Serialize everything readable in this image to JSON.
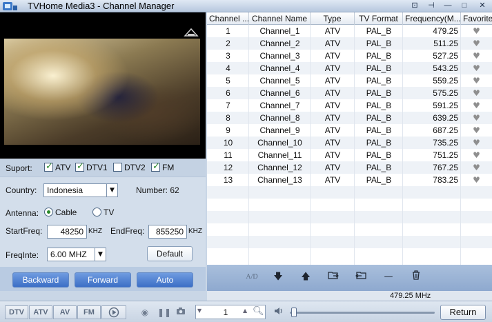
{
  "window": {
    "title": "TVHome Media3 - Channel Manager",
    "controls": [
      "⊡",
      "⊣",
      "—",
      "□",
      "✕"
    ]
  },
  "support": {
    "label": "Suport:",
    "options": [
      {
        "label": "ATV",
        "checked": true
      },
      {
        "label": "DTV1",
        "checked": true
      },
      {
        "label": "DTV2",
        "checked": false
      },
      {
        "label": "FM",
        "checked": true
      }
    ]
  },
  "country": {
    "label": "Country:",
    "value": "Indonesia",
    "number_label": "Number: 62"
  },
  "antenna": {
    "label": "Antenna:",
    "options": [
      {
        "label": "Cable",
        "selected": true
      },
      {
        "label": "TV",
        "selected": false
      }
    ]
  },
  "freq": {
    "start_label": "StartFreq:",
    "start_value": "48250",
    "start_unit": "KHZ",
    "end_label": "EndFreq:",
    "end_value": "855250",
    "end_unit": "KHZ"
  },
  "freqinte": {
    "label": "FreqInte:",
    "value": "6.00 MHZ",
    "default_button": "Default"
  },
  "scan_buttons": {
    "backward": "Backward",
    "forward": "Forward",
    "auto": "Auto"
  },
  "table": {
    "columns": [
      "Channel ...",
      "Channel Name",
      "Type",
      "TV Format",
      "Frequency(M...",
      "Favorites"
    ],
    "rows": [
      {
        "num": "1",
        "name": "Channel_1",
        "type": "ATV",
        "format": "PAL_B",
        "freq": "479.25"
      },
      {
        "num": "2",
        "name": "Channel_2",
        "type": "ATV",
        "format": "PAL_B",
        "freq": "511.25"
      },
      {
        "num": "3",
        "name": "Channel_3",
        "type": "ATV",
        "format": "PAL_B",
        "freq": "527.25"
      },
      {
        "num": "4",
        "name": "Channel_4",
        "type": "ATV",
        "format": "PAL_B",
        "freq": "543.25"
      },
      {
        "num": "5",
        "name": "Channel_5",
        "type": "ATV",
        "format": "PAL_B",
        "freq": "559.25"
      },
      {
        "num": "6",
        "name": "Channel_6",
        "type": "ATV",
        "format": "PAL_B",
        "freq": "575.25"
      },
      {
        "num": "7",
        "name": "Channel_7",
        "type": "ATV",
        "format": "PAL_B",
        "freq": "591.25"
      },
      {
        "num": "8",
        "name": "Channel_8",
        "type": "ATV",
        "format": "PAL_B",
        "freq": "639.25"
      },
      {
        "num": "9",
        "name": "Channel_9",
        "type": "ATV",
        "format": "PAL_B",
        "freq": "687.25"
      },
      {
        "num": "10",
        "name": "Channel_10",
        "type": "ATV",
        "format": "PAL_B",
        "freq": "735.25"
      },
      {
        "num": "11",
        "name": "Channel_11",
        "type": "ATV",
        "format": "PAL_B",
        "freq": "751.25"
      },
      {
        "num": "12",
        "name": "Channel_12",
        "type": "ATV",
        "format": "PAL_B",
        "freq": "767.25"
      },
      {
        "num": "13",
        "name": "Channel_13",
        "type": "ATV",
        "format": "PAL_B",
        "freq": "783.25"
      }
    ],
    "favorite_glyph": "♥"
  },
  "toolbar": {
    "ad_label": "A/D",
    "icons": [
      "move-down-icon",
      "move-up-icon",
      "import-icon",
      "export-icon",
      "remove-icon",
      "delete-icon"
    ]
  },
  "status": {
    "frequency": "479.25 MHz"
  },
  "bottom": {
    "modes": [
      "DTV",
      "ATV",
      "AV",
      "FM"
    ],
    "channel_value": "1",
    "return_label": "Return"
  },
  "colors": {
    "accent_blue": "#3c6fc6",
    "check_green": "#2a8a2a",
    "panel": "#d3deeb"
  }
}
